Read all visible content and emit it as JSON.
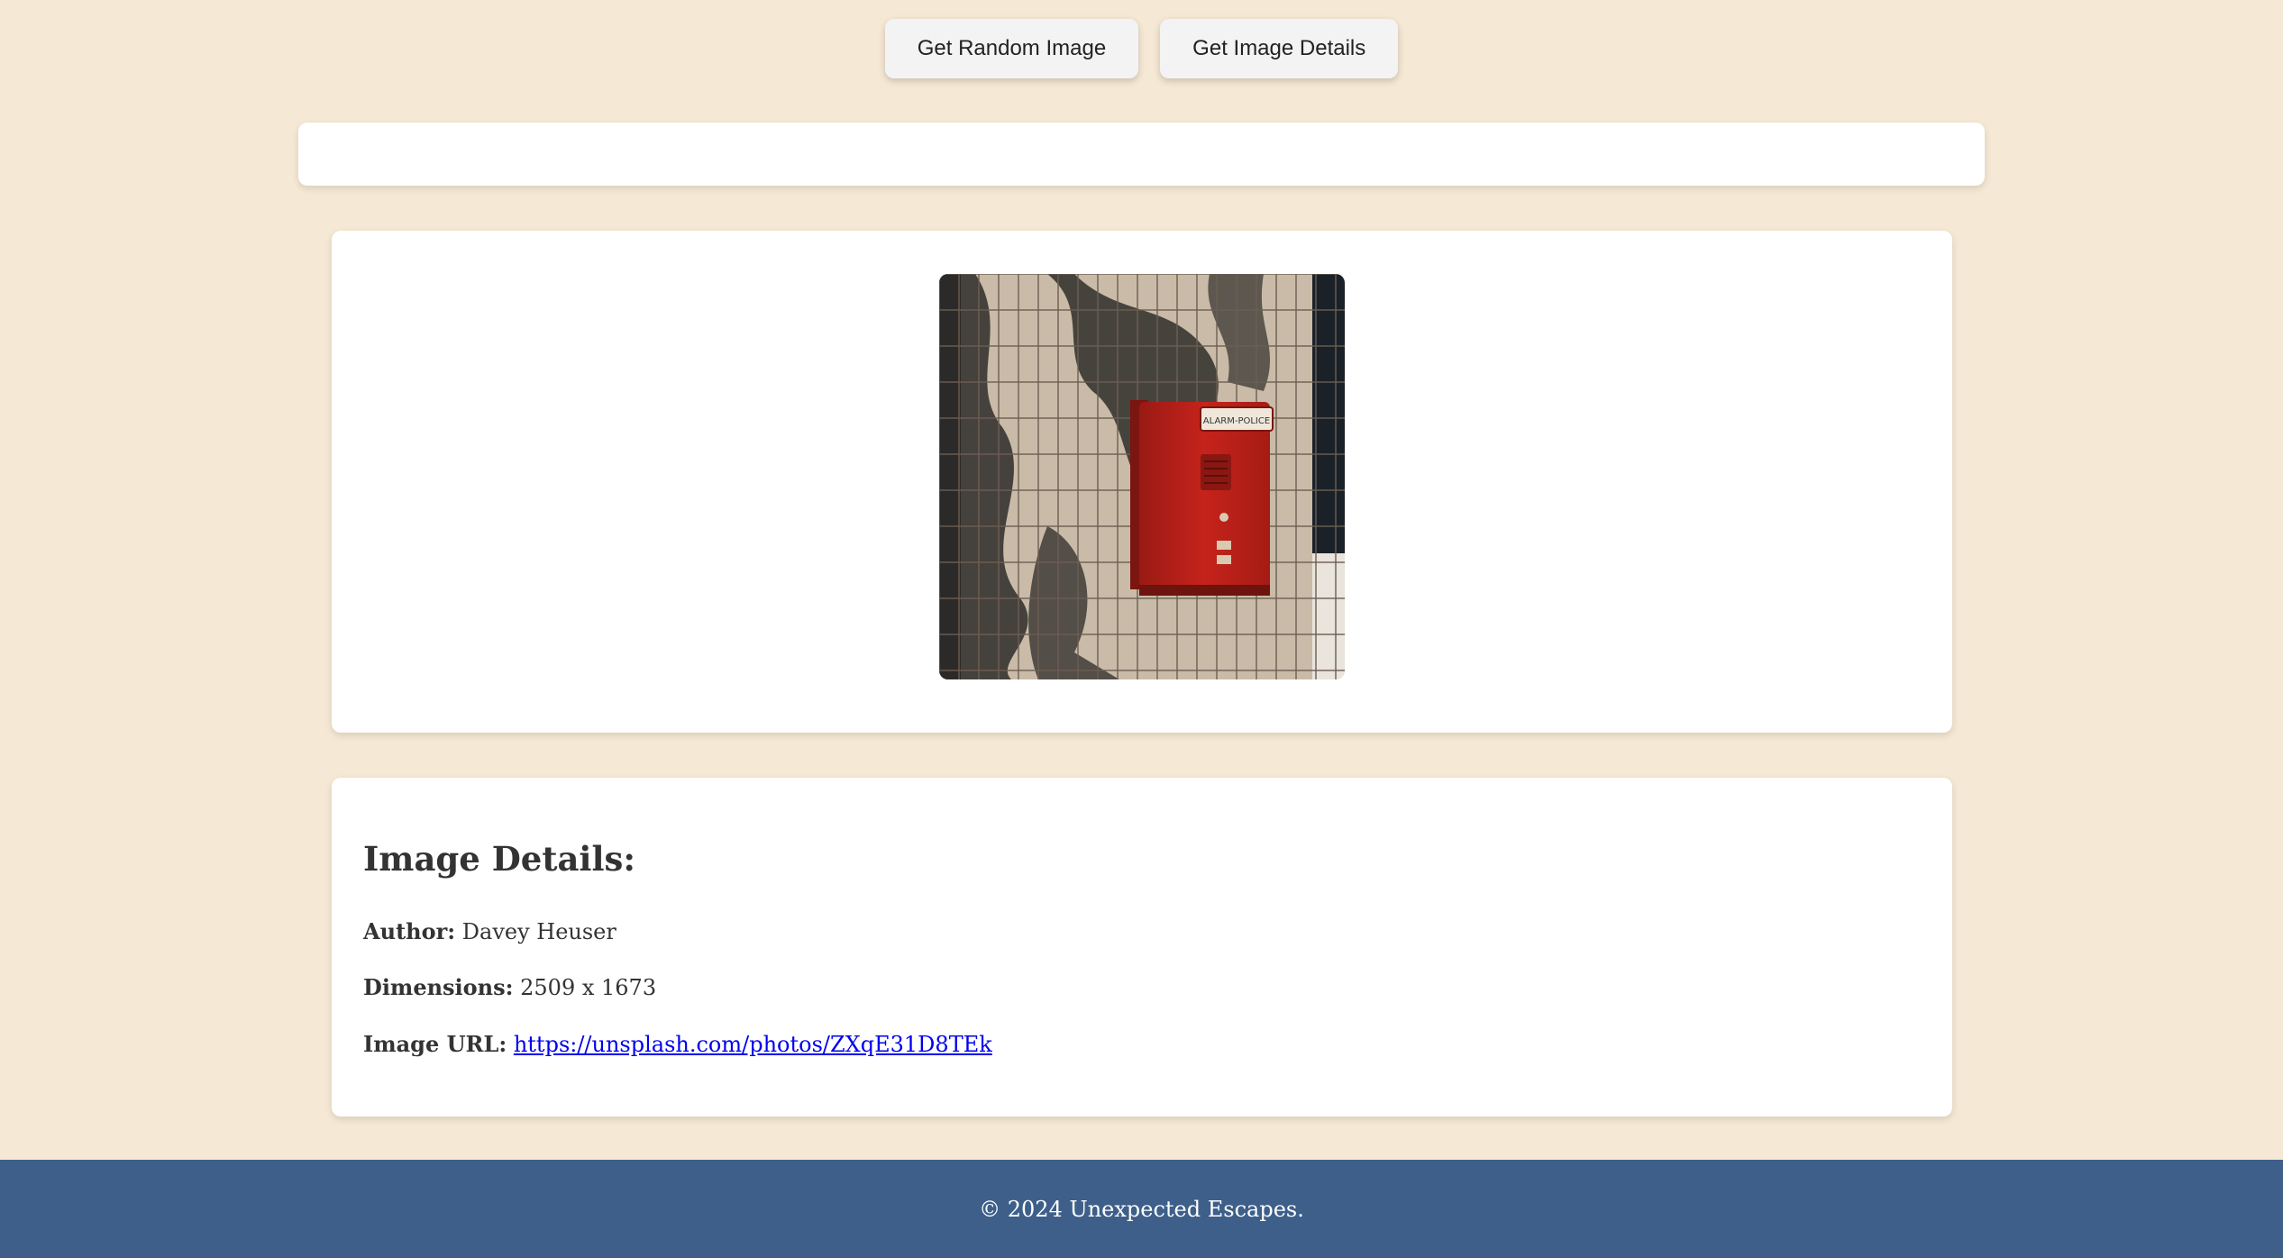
{
  "toolbar": {
    "random_label": "Get Random Image",
    "details_label": "Get Image Details"
  },
  "status": {
    "text": ""
  },
  "image": {
    "subject": "red alarm box on tiled wall"
  },
  "details": {
    "title": "Image Details:",
    "author_label": "Author:",
    "author_value": "Davey Heuser",
    "dimensions_label": "Dimensions:",
    "dimensions_value": "2509 x 1673",
    "url_label": "Image URL:",
    "url_value": "https://unsplash.com/photos/ZXqE31D8TEk"
  },
  "footer": {
    "text": "© 2024 Unexpected Escapes."
  },
  "colors": {
    "background": "#f5e8d4",
    "footer": "#3d5f8a",
    "link": "#0000ee",
    "alarm_red": "#c5231b"
  }
}
